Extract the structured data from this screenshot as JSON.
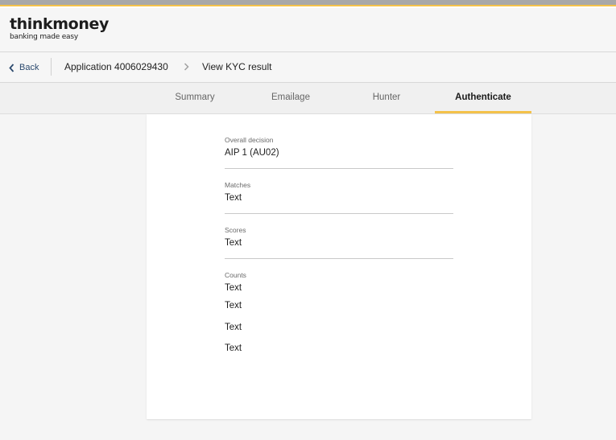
{
  "brand": {
    "name": "thinkmoney",
    "tagline": "banking made easy"
  },
  "colors": {
    "accent": "#f4c24a",
    "link": "#2c4a6e"
  },
  "breadcrumb": {
    "back_label": "Back",
    "application": "Application 4006029430",
    "current": "View KYC result"
  },
  "tabs": [
    "Summary",
    "Emailage",
    "Hunter",
    "Authenticate"
  ],
  "active_tab": "Authenticate",
  "fields": {
    "overall": {
      "label": "Overall decision",
      "value": "AIP 1 (AU02)"
    },
    "matches": {
      "label": "Matches",
      "value": "Text"
    },
    "scores": {
      "label": "Scores",
      "value": "Text"
    },
    "counts": {
      "label": "Counts",
      "values": [
        "Text",
        "Text",
        "Text",
        "Text"
      ]
    }
  }
}
